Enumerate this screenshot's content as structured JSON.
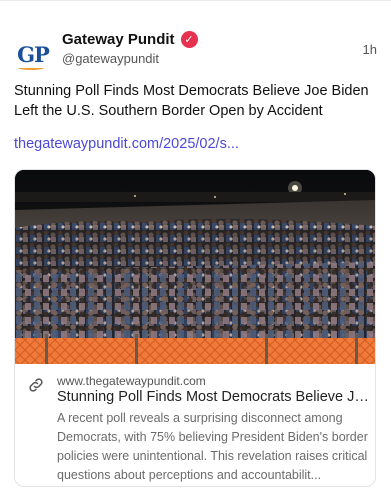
{
  "author": {
    "display_name": "Gateway Pundit",
    "handle": "@gatewaypundit",
    "avatar_text": "GP",
    "verified_icon": "verified-badge-icon",
    "verified_color": "#e8304f"
  },
  "post": {
    "timestamp": "1h",
    "text": "Stunning Poll Finds Most Democrats Believe Joe Biden Left the U.S. Southern Border Open by Accident",
    "link_text": "thegatewaypundit.com/2025/02/s...",
    "link_color": "#4b48d6"
  },
  "card": {
    "domain": "www.thegatewaypundit.com",
    "title": "Stunning Poll Finds Most Democrats Believe Jo...",
    "description": "A recent poll reveals a surprising disconnect among Democrats, with 75% believing President Biden's border policies were unintentional. This revelation raises critical questions about perceptions and accountabilit...",
    "image_subject": "crowd at border fence at night",
    "link_icon": "link-icon"
  }
}
